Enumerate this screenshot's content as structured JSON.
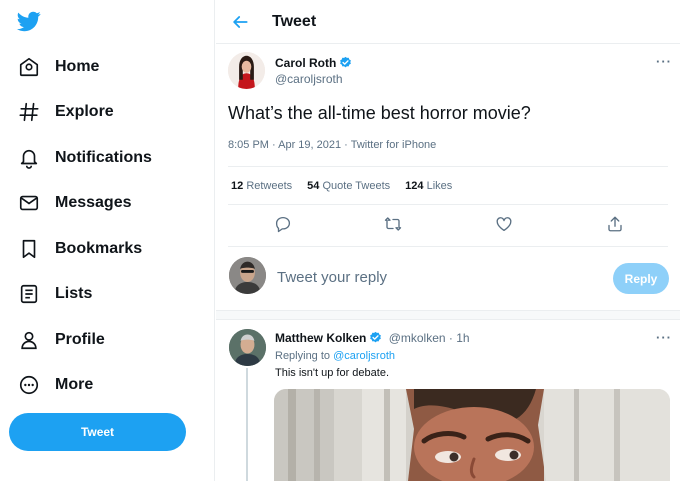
{
  "sidebar": {
    "logo_icon": "twitter-bird-icon",
    "items": [
      {
        "label": "Home",
        "icon": "home-icon"
      },
      {
        "label": "Explore",
        "icon": "hashtag-icon"
      },
      {
        "label": "Notifications",
        "icon": "bell-icon"
      },
      {
        "label": "Messages",
        "icon": "envelope-icon"
      },
      {
        "label": "Bookmarks",
        "icon": "bookmark-icon"
      },
      {
        "label": "Lists",
        "icon": "list-icon"
      },
      {
        "label": "Profile",
        "icon": "person-icon"
      },
      {
        "label": "More",
        "icon": "more-circle-icon"
      }
    ],
    "tweet_button": "Tweet"
  },
  "header": {
    "title": "Tweet"
  },
  "tweet": {
    "author_name": "Carol Roth",
    "author_handle": "@caroljsroth",
    "text": "What’s the all-time best horror movie?",
    "meta": "8:05 PM · Apr 19, 2021 · Twitter for iPhone",
    "stats": {
      "retweets_count": "12",
      "retweets_label": "Retweets",
      "quotes_count": "54",
      "quotes_label": "Quote Tweets",
      "likes_count": "124",
      "likes_label": "Likes"
    },
    "more": "···"
  },
  "compose": {
    "placeholder": "Tweet your reply",
    "button": "Reply"
  },
  "reply": {
    "author_name": "Matthew Kolken",
    "author_handle_time": "@mkolken · 1h",
    "replying_prefix": "Replying to",
    "replying_to": "@caroljsroth",
    "text": "This isn't up for debate.",
    "more": "···"
  },
  "colors": {
    "accent": "#1da1f2",
    "reply_button_disabled": "#8ed0f9",
    "secondary_text": "#5b7083"
  }
}
